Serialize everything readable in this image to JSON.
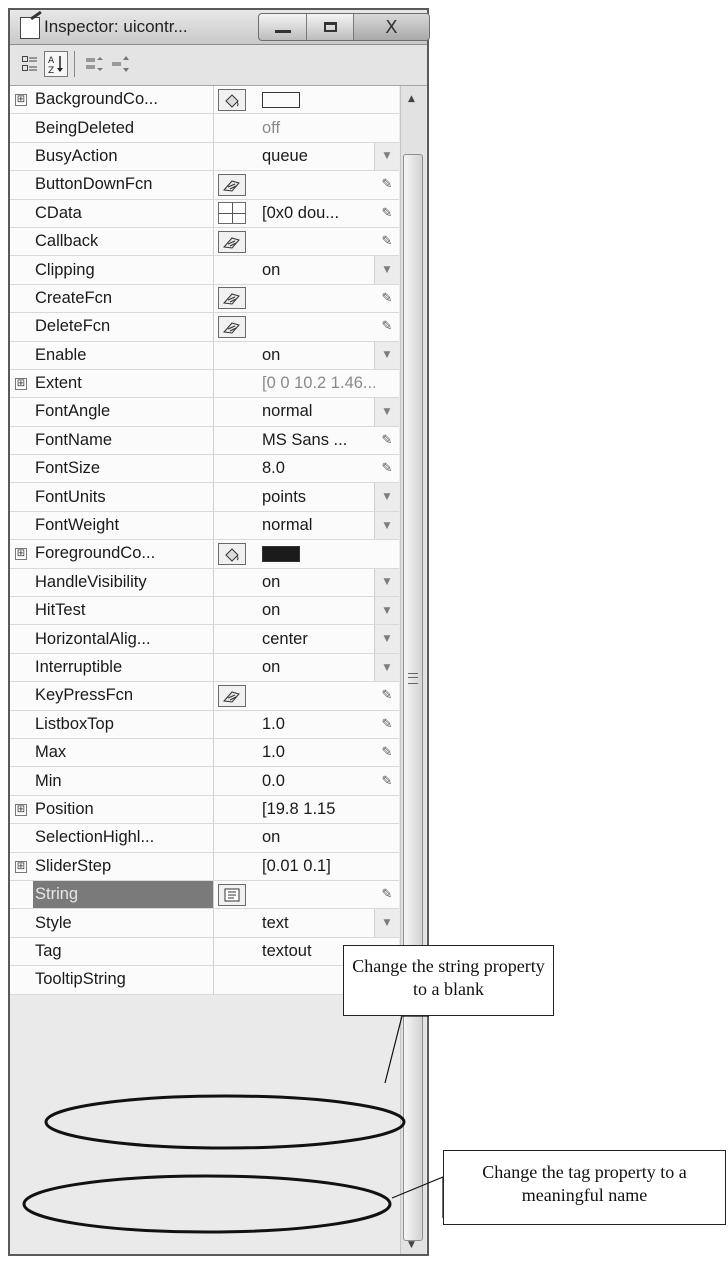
{
  "window": {
    "title": "Inspector:  uicontr...",
    "buttons": {
      "minimize": "",
      "maximize": "",
      "close": "X"
    }
  },
  "toolbar": {
    "buttons": [
      {
        "name": "categorized-icon"
      },
      {
        "name": "sort-alphabetical-icon"
      },
      {
        "name": "expand-all-icon"
      },
      {
        "name": "collapse-all-icon"
      }
    ]
  },
  "properties": [
    {
      "name": "BackgroundCo...",
      "expand": true,
      "btn": "paint",
      "value": "",
      "value_type": "swatch-white",
      "edit": "none"
    },
    {
      "name": "BeingDeleted",
      "expand": false,
      "btn": "",
      "value": "off",
      "value_type": "dim",
      "edit": "none"
    },
    {
      "name": "BusyAction",
      "expand": false,
      "btn": "",
      "value": "queue",
      "value_type": "text",
      "edit": "drop"
    },
    {
      "name": "ButtonDownFcn",
      "expand": false,
      "btn": "callback",
      "value": "",
      "value_type": "text",
      "edit": "pencil"
    },
    {
      "name": "CData",
      "expand": false,
      "btn": "grid",
      "value": "[0x0  dou...",
      "value_type": "text",
      "edit": "pencil"
    },
    {
      "name": "Callback",
      "expand": false,
      "btn": "callback",
      "value": "",
      "value_type": "text",
      "edit": "pencil"
    },
    {
      "name": "Clipping",
      "expand": false,
      "btn": "",
      "value": "on",
      "value_type": "text",
      "edit": "drop"
    },
    {
      "name": "CreateFcn",
      "expand": false,
      "btn": "callback",
      "value": "",
      "value_type": "text",
      "edit": "pencil"
    },
    {
      "name": "DeleteFcn",
      "expand": false,
      "btn": "callback",
      "value": "",
      "value_type": "text",
      "edit": "pencil"
    },
    {
      "name": "Enable",
      "expand": false,
      "btn": "",
      "value": "on",
      "value_type": "text",
      "edit": "drop"
    },
    {
      "name": "Extent",
      "expand": true,
      "btn": "",
      "value": "[0 0 10.2 1.46...",
      "value_type": "dim",
      "edit": "none"
    },
    {
      "name": "FontAngle",
      "expand": false,
      "btn": "",
      "value": "normal",
      "value_type": "text",
      "edit": "drop"
    },
    {
      "name": "FontName",
      "expand": false,
      "btn": "",
      "value": "MS Sans ...",
      "value_type": "text",
      "edit": "pencil"
    },
    {
      "name": "FontSize",
      "expand": false,
      "btn": "",
      "value": "8.0",
      "value_type": "text",
      "edit": "pencil"
    },
    {
      "name": "FontUnits",
      "expand": false,
      "btn": "",
      "value": "points",
      "value_type": "text",
      "edit": "drop"
    },
    {
      "name": "FontWeight",
      "expand": false,
      "btn": "",
      "value": "normal",
      "value_type": "text",
      "edit": "drop"
    },
    {
      "name": "ForegroundCo...",
      "expand": true,
      "btn": "paint",
      "value": "",
      "value_type": "swatch-black",
      "edit": "none"
    },
    {
      "name": "HandleVisibility",
      "expand": false,
      "btn": "",
      "value": "on",
      "value_type": "text",
      "edit": "drop"
    },
    {
      "name": "HitTest",
      "expand": false,
      "btn": "",
      "value": "on",
      "value_type": "text",
      "edit": "drop"
    },
    {
      "name": "HorizontalAlig...",
      "expand": false,
      "btn": "",
      "value": "center",
      "value_type": "text",
      "edit": "drop"
    },
    {
      "name": "Interruptible",
      "expand": false,
      "btn": "",
      "value": "on",
      "value_type": "text",
      "edit": "drop"
    },
    {
      "name": "KeyPressFcn",
      "expand": false,
      "btn": "callback",
      "value": "",
      "value_type": "text",
      "edit": "pencil"
    },
    {
      "name": "ListboxTop",
      "expand": false,
      "btn": "",
      "value": "1.0",
      "value_type": "text",
      "edit": "pencil"
    },
    {
      "name": "Max",
      "expand": false,
      "btn": "",
      "value": "1.0",
      "value_type": "text",
      "edit": "pencil"
    },
    {
      "name": "Min",
      "expand": false,
      "btn": "",
      "value": "0.0",
      "value_type": "text",
      "edit": "pencil"
    },
    {
      "name": "Position",
      "expand": true,
      "btn": "",
      "value": "[19.8 1.15",
      "value_type": "text",
      "edit": "none"
    },
    {
      "name": "SelectionHighl...",
      "expand": false,
      "btn": "",
      "value": "on",
      "value_type": "text",
      "edit": "none"
    },
    {
      "name": "SliderStep",
      "expand": true,
      "btn": "",
      "value": "[0.01 0.1]",
      "value_type": "text",
      "edit": "none"
    },
    {
      "name": "String",
      "expand": false,
      "btn": "text",
      "value": "",
      "value_type": "text",
      "edit": "pencil",
      "selected": true
    },
    {
      "name": "Style",
      "expand": false,
      "btn": "",
      "value": "text",
      "value_type": "text",
      "edit": "drop"
    },
    {
      "name": "Tag",
      "expand": false,
      "btn": "",
      "value": "textout",
      "value_type": "text",
      "edit": "pencil"
    },
    {
      "name": "TooltipString",
      "expand": false,
      "btn": "",
      "value": "",
      "value_type": "text",
      "edit": "pencil"
    }
  ],
  "annotations": {
    "callout_string": "Change the string property to a blank",
    "callout_tag": "Change the tag property to a meaningful name"
  },
  "icons": {
    "expand": "⊞",
    "pencil": "✎",
    "dropdown": "▼",
    "scroll_up": "▲",
    "scroll_down": "▼"
  }
}
